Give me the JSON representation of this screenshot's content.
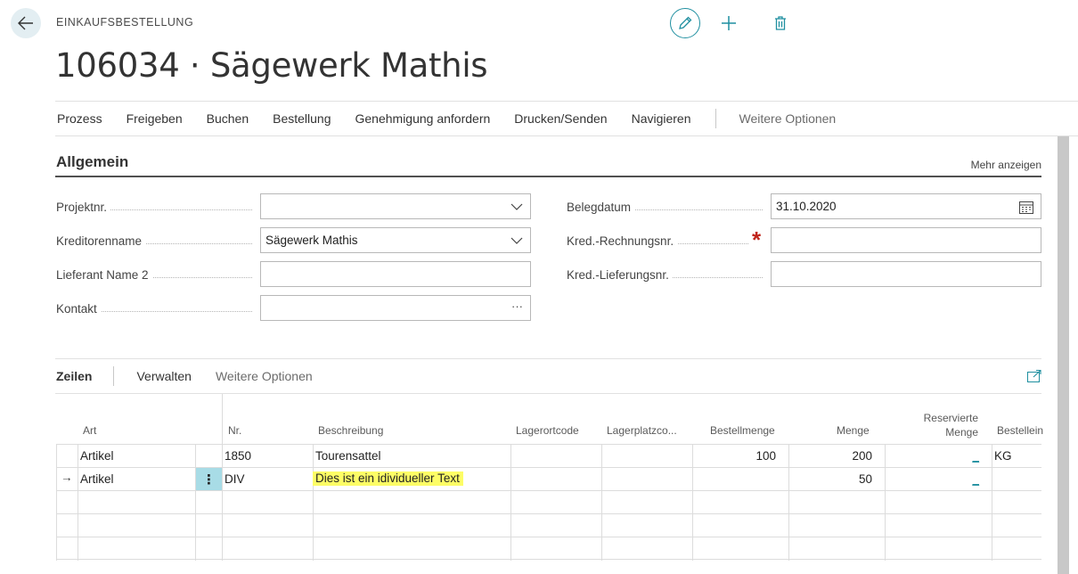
{
  "header": {
    "page_type": "EINKAUFSBESTELLUNG",
    "title": "106034 · Sägewerk Mathis"
  },
  "actions": {
    "items": [
      "Prozess",
      "Freigeben",
      "Buchen",
      "Bestellung",
      "Genehmigung anfordern",
      "Drucken/Senden",
      "Navigieren"
    ],
    "more": "Weitere Optionen"
  },
  "general": {
    "title": "Allgemein",
    "show_more": "Mehr anzeigen",
    "fields": {
      "projektnr": {
        "label": "Projektnr.",
        "value": ""
      },
      "kreditorenname": {
        "label": "Kreditorenname",
        "value": "Sägewerk Mathis"
      },
      "lieferant_name2": {
        "label": "Lieferant Name 2",
        "value": ""
      },
      "kontakt": {
        "label": "Kontakt",
        "value": "",
        "button": "···"
      },
      "belegdatum": {
        "label": "Belegdatum",
        "value": "31.10.2020"
      },
      "kred_rechnungsnr": {
        "label": "Kred.-Rechnungsnr.",
        "value": "",
        "required_mark": "*"
      },
      "kred_lieferungsnr": {
        "label": "Kred.-Lieferungsnr.",
        "value": ""
      }
    }
  },
  "lines": {
    "title": "Zeilen",
    "actions": [
      "Verwalten",
      "Weitere Optionen"
    ],
    "columns": {
      "art": "Art",
      "nr": "Nr.",
      "beschreibung": "Beschreibung",
      "lagerortcode": "Lagerortcode",
      "lagerplatzcode": "Lagerplatzco...",
      "bestellmenge": "Bestellmenge",
      "menge": "Menge",
      "reserviert1": "Reservierte",
      "reserviert2": "Menge",
      "bestelleinheit": "Bestellein"
    },
    "rows": [
      {
        "arrow": "",
        "art": "Artikel",
        "nr": "1850",
        "beschreibung": "Tourensattel",
        "bestellmenge": "100",
        "menge": "200",
        "reserviert": "_",
        "einheit": "KG"
      },
      {
        "arrow": "→",
        "art": "Artikel",
        "menu": "⋮",
        "nr": "DIV",
        "beschreibung": "Dies ist ein idividueller Text",
        "bestellmenge": "",
        "menge": "50",
        "reserviert": "_",
        "einheit": ""
      }
    ]
  },
  "colors": {
    "accent": "#1f8fa0",
    "highlight": "#fdfd66",
    "required": "#c0241b",
    "selected_cell": "#a8dce6"
  }
}
